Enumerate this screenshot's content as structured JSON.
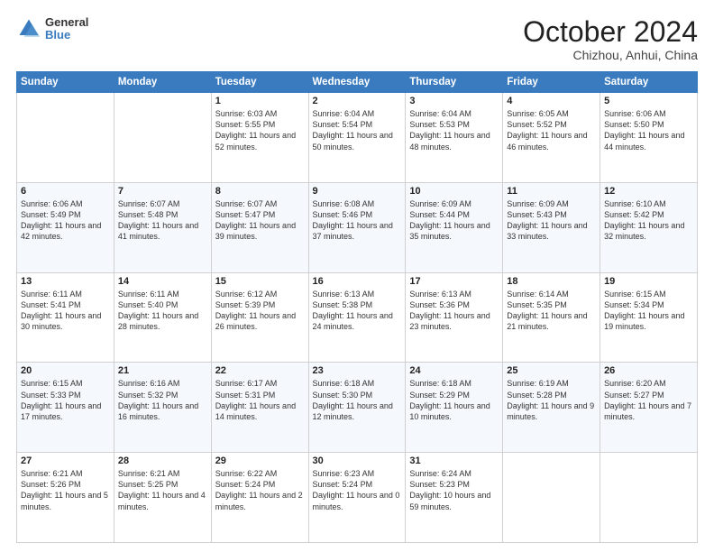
{
  "header": {
    "logo": {
      "general": "General",
      "blue": "Blue"
    },
    "title": "October 2024",
    "location": "Chizhou, Anhui, China"
  },
  "weekdays": [
    "Sunday",
    "Monday",
    "Tuesday",
    "Wednesday",
    "Thursday",
    "Friday",
    "Saturday"
  ],
  "weeks": [
    [
      {
        "day": "",
        "sunrise": "",
        "sunset": "",
        "daylight": ""
      },
      {
        "day": "",
        "sunrise": "",
        "sunset": "",
        "daylight": ""
      },
      {
        "day": "1",
        "sunrise": "Sunrise: 6:03 AM",
        "sunset": "Sunset: 5:55 PM",
        "daylight": "Daylight: 11 hours and 52 minutes."
      },
      {
        "day": "2",
        "sunrise": "Sunrise: 6:04 AM",
        "sunset": "Sunset: 5:54 PM",
        "daylight": "Daylight: 11 hours and 50 minutes."
      },
      {
        "day": "3",
        "sunrise": "Sunrise: 6:04 AM",
        "sunset": "Sunset: 5:53 PM",
        "daylight": "Daylight: 11 hours and 48 minutes."
      },
      {
        "day": "4",
        "sunrise": "Sunrise: 6:05 AM",
        "sunset": "Sunset: 5:52 PM",
        "daylight": "Daylight: 11 hours and 46 minutes."
      },
      {
        "day": "5",
        "sunrise": "Sunrise: 6:06 AM",
        "sunset": "Sunset: 5:50 PM",
        "daylight": "Daylight: 11 hours and 44 minutes."
      }
    ],
    [
      {
        "day": "6",
        "sunrise": "Sunrise: 6:06 AM",
        "sunset": "Sunset: 5:49 PM",
        "daylight": "Daylight: 11 hours and 42 minutes."
      },
      {
        "day": "7",
        "sunrise": "Sunrise: 6:07 AM",
        "sunset": "Sunset: 5:48 PM",
        "daylight": "Daylight: 11 hours and 41 minutes."
      },
      {
        "day": "8",
        "sunrise": "Sunrise: 6:07 AM",
        "sunset": "Sunset: 5:47 PM",
        "daylight": "Daylight: 11 hours and 39 minutes."
      },
      {
        "day": "9",
        "sunrise": "Sunrise: 6:08 AM",
        "sunset": "Sunset: 5:46 PM",
        "daylight": "Daylight: 11 hours and 37 minutes."
      },
      {
        "day": "10",
        "sunrise": "Sunrise: 6:09 AM",
        "sunset": "Sunset: 5:44 PM",
        "daylight": "Daylight: 11 hours and 35 minutes."
      },
      {
        "day": "11",
        "sunrise": "Sunrise: 6:09 AM",
        "sunset": "Sunset: 5:43 PM",
        "daylight": "Daylight: 11 hours and 33 minutes."
      },
      {
        "day": "12",
        "sunrise": "Sunrise: 6:10 AM",
        "sunset": "Sunset: 5:42 PM",
        "daylight": "Daylight: 11 hours and 32 minutes."
      }
    ],
    [
      {
        "day": "13",
        "sunrise": "Sunrise: 6:11 AM",
        "sunset": "Sunset: 5:41 PM",
        "daylight": "Daylight: 11 hours and 30 minutes."
      },
      {
        "day": "14",
        "sunrise": "Sunrise: 6:11 AM",
        "sunset": "Sunset: 5:40 PM",
        "daylight": "Daylight: 11 hours and 28 minutes."
      },
      {
        "day": "15",
        "sunrise": "Sunrise: 6:12 AM",
        "sunset": "Sunset: 5:39 PM",
        "daylight": "Daylight: 11 hours and 26 minutes."
      },
      {
        "day": "16",
        "sunrise": "Sunrise: 6:13 AM",
        "sunset": "Sunset: 5:38 PM",
        "daylight": "Daylight: 11 hours and 24 minutes."
      },
      {
        "day": "17",
        "sunrise": "Sunrise: 6:13 AM",
        "sunset": "Sunset: 5:36 PM",
        "daylight": "Daylight: 11 hours and 23 minutes."
      },
      {
        "day": "18",
        "sunrise": "Sunrise: 6:14 AM",
        "sunset": "Sunset: 5:35 PM",
        "daylight": "Daylight: 11 hours and 21 minutes."
      },
      {
        "day": "19",
        "sunrise": "Sunrise: 6:15 AM",
        "sunset": "Sunset: 5:34 PM",
        "daylight": "Daylight: 11 hours and 19 minutes."
      }
    ],
    [
      {
        "day": "20",
        "sunrise": "Sunrise: 6:15 AM",
        "sunset": "Sunset: 5:33 PM",
        "daylight": "Daylight: 11 hours and 17 minutes."
      },
      {
        "day": "21",
        "sunrise": "Sunrise: 6:16 AM",
        "sunset": "Sunset: 5:32 PM",
        "daylight": "Daylight: 11 hours and 16 minutes."
      },
      {
        "day": "22",
        "sunrise": "Sunrise: 6:17 AM",
        "sunset": "Sunset: 5:31 PM",
        "daylight": "Daylight: 11 hours and 14 minutes."
      },
      {
        "day": "23",
        "sunrise": "Sunrise: 6:18 AM",
        "sunset": "Sunset: 5:30 PM",
        "daylight": "Daylight: 11 hours and 12 minutes."
      },
      {
        "day": "24",
        "sunrise": "Sunrise: 6:18 AM",
        "sunset": "Sunset: 5:29 PM",
        "daylight": "Daylight: 11 hours and 10 minutes."
      },
      {
        "day": "25",
        "sunrise": "Sunrise: 6:19 AM",
        "sunset": "Sunset: 5:28 PM",
        "daylight": "Daylight: 11 hours and 9 minutes."
      },
      {
        "day": "26",
        "sunrise": "Sunrise: 6:20 AM",
        "sunset": "Sunset: 5:27 PM",
        "daylight": "Daylight: 11 hours and 7 minutes."
      }
    ],
    [
      {
        "day": "27",
        "sunrise": "Sunrise: 6:21 AM",
        "sunset": "Sunset: 5:26 PM",
        "daylight": "Daylight: 11 hours and 5 minutes."
      },
      {
        "day": "28",
        "sunrise": "Sunrise: 6:21 AM",
        "sunset": "Sunset: 5:25 PM",
        "daylight": "Daylight: 11 hours and 4 minutes."
      },
      {
        "day": "29",
        "sunrise": "Sunrise: 6:22 AM",
        "sunset": "Sunset: 5:24 PM",
        "daylight": "Daylight: 11 hours and 2 minutes."
      },
      {
        "day": "30",
        "sunrise": "Sunrise: 6:23 AM",
        "sunset": "Sunset: 5:24 PM",
        "daylight": "Daylight: 11 hours and 0 minutes."
      },
      {
        "day": "31",
        "sunrise": "Sunrise: 6:24 AM",
        "sunset": "Sunset: 5:23 PM",
        "daylight": "Daylight: 10 hours and 59 minutes."
      },
      {
        "day": "",
        "sunrise": "",
        "sunset": "",
        "daylight": ""
      },
      {
        "day": "",
        "sunrise": "",
        "sunset": "",
        "daylight": ""
      }
    ]
  ]
}
